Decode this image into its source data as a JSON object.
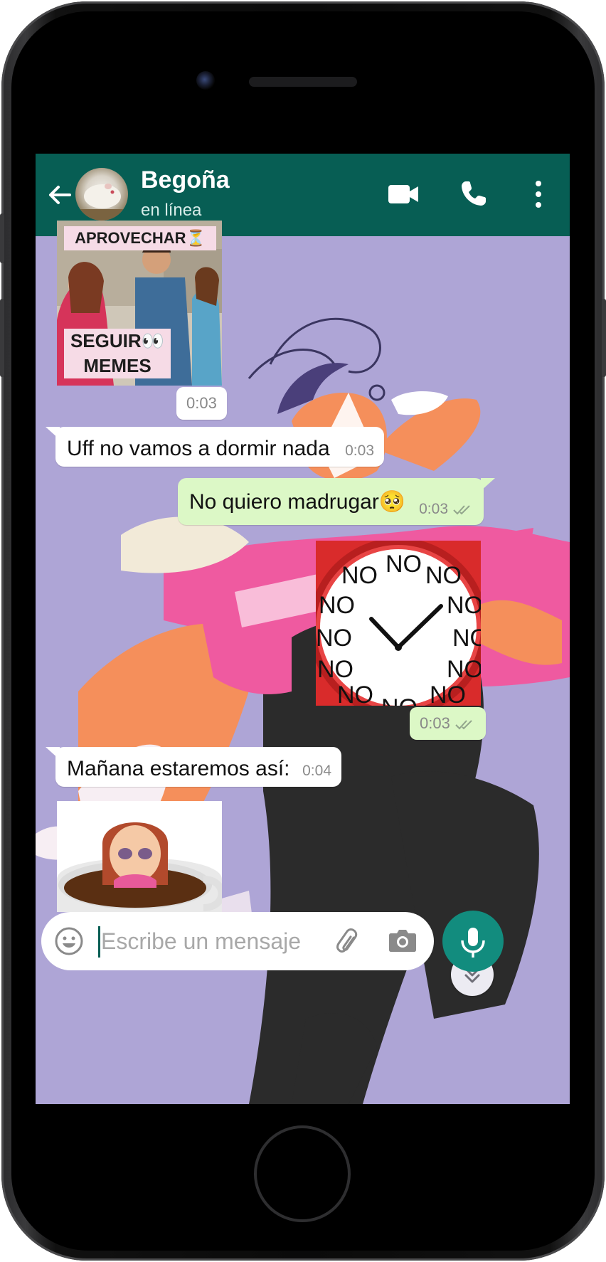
{
  "header": {
    "back_icon": "arrow-left-icon",
    "contact_name": "Begoña",
    "contact_status": "en línea",
    "icons": [
      "video-call-icon",
      "phone-call-icon",
      "more-vertical-icon"
    ]
  },
  "messages": [
    {
      "kind": "sticker",
      "direction": "in",
      "sticker": "distracted-boyfriend-meme",
      "labels": {
        "top": "APROVECHAR⏳",
        "bottom_line1": "SEGUIR👀",
        "bottom_line2": "MEMES"
      },
      "time": "0:03"
    },
    {
      "kind": "text",
      "direction": "in",
      "text": "Uff no vamos a dormir nada",
      "time": "0:03"
    },
    {
      "kind": "text",
      "direction": "out",
      "text": "No quiero madrugar🥺",
      "time": "0:03",
      "read": true
    },
    {
      "kind": "sticker",
      "direction": "out",
      "sticker": "alarm-clock-no",
      "clock_words": [
        "NO",
        "NO",
        "NO",
        "NO",
        "NO",
        "NO",
        "NO",
        "NO",
        "NO",
        "NO",
        "NO",
        "NO"
      ],
      "time": "0:03",
      "read": true
    },
    {
      "kind": "text",
      "direction": "in",
      "text": "Mañana estaremos así:",
      "time": "0:04"
    },
    {
      "kind": "sticker",
      "direction": "in",
      "sticker": "woman-in-coffee-cup"
    }
  ],
  "composer": {
    "placeholder": "Escribe un mensaje",
    "value": "",
    "icons": [
      "emoji-icon",
      "paperclip-icon",
      "camera-icon",
      "microphone-icon"
    ]
  },
  "colors": {
    "header": "#075e54",
    "outgoing_bubble": "#dcf8c6",
    "incoming_bubble": "#ffffff",
    "wallpaper": "#aea5d6",
    "mic_button": "#128c7e"
  }
}
